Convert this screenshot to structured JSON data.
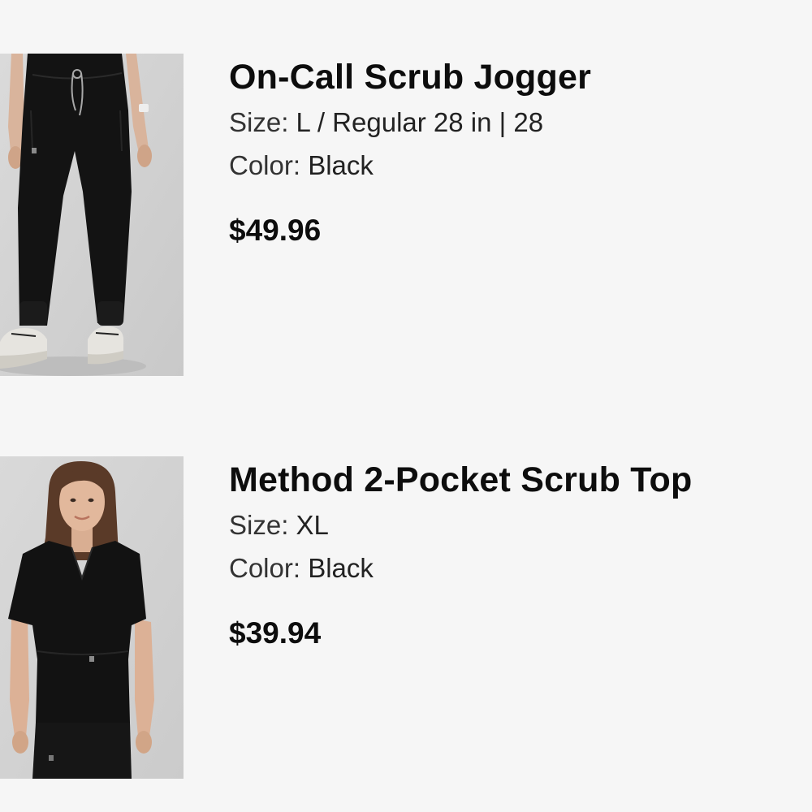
{
  "cart_items": [
    {
      "image_alt": "On-Call Scrub Jogger product photo",
      "title": "On-Call Scrub Jogger",
      "size_label": "Size:",
      "size_value": "L / Regular 28 in | 28",
      "color_label": "Color:",
      "color_value": "Black",
      "price": "$49.96"
    },
    {
      "image_alt": "Method 2-Pocket Scrub Top product photo",
      "title": "Method 2-Pocket Scrub Top",
      "size_label": "Size:",
      "size_value": "XL",
      "color_label": "Color:",
      "color_value": "Black",
      "price": "$39.94"
    }
  ],
  "colors": {
    "background": "#f6f6f6",
    "text": "#111111",
    "photo_backdrop": "#d5d5d5",
    "garment": "#111111"
  }
}
